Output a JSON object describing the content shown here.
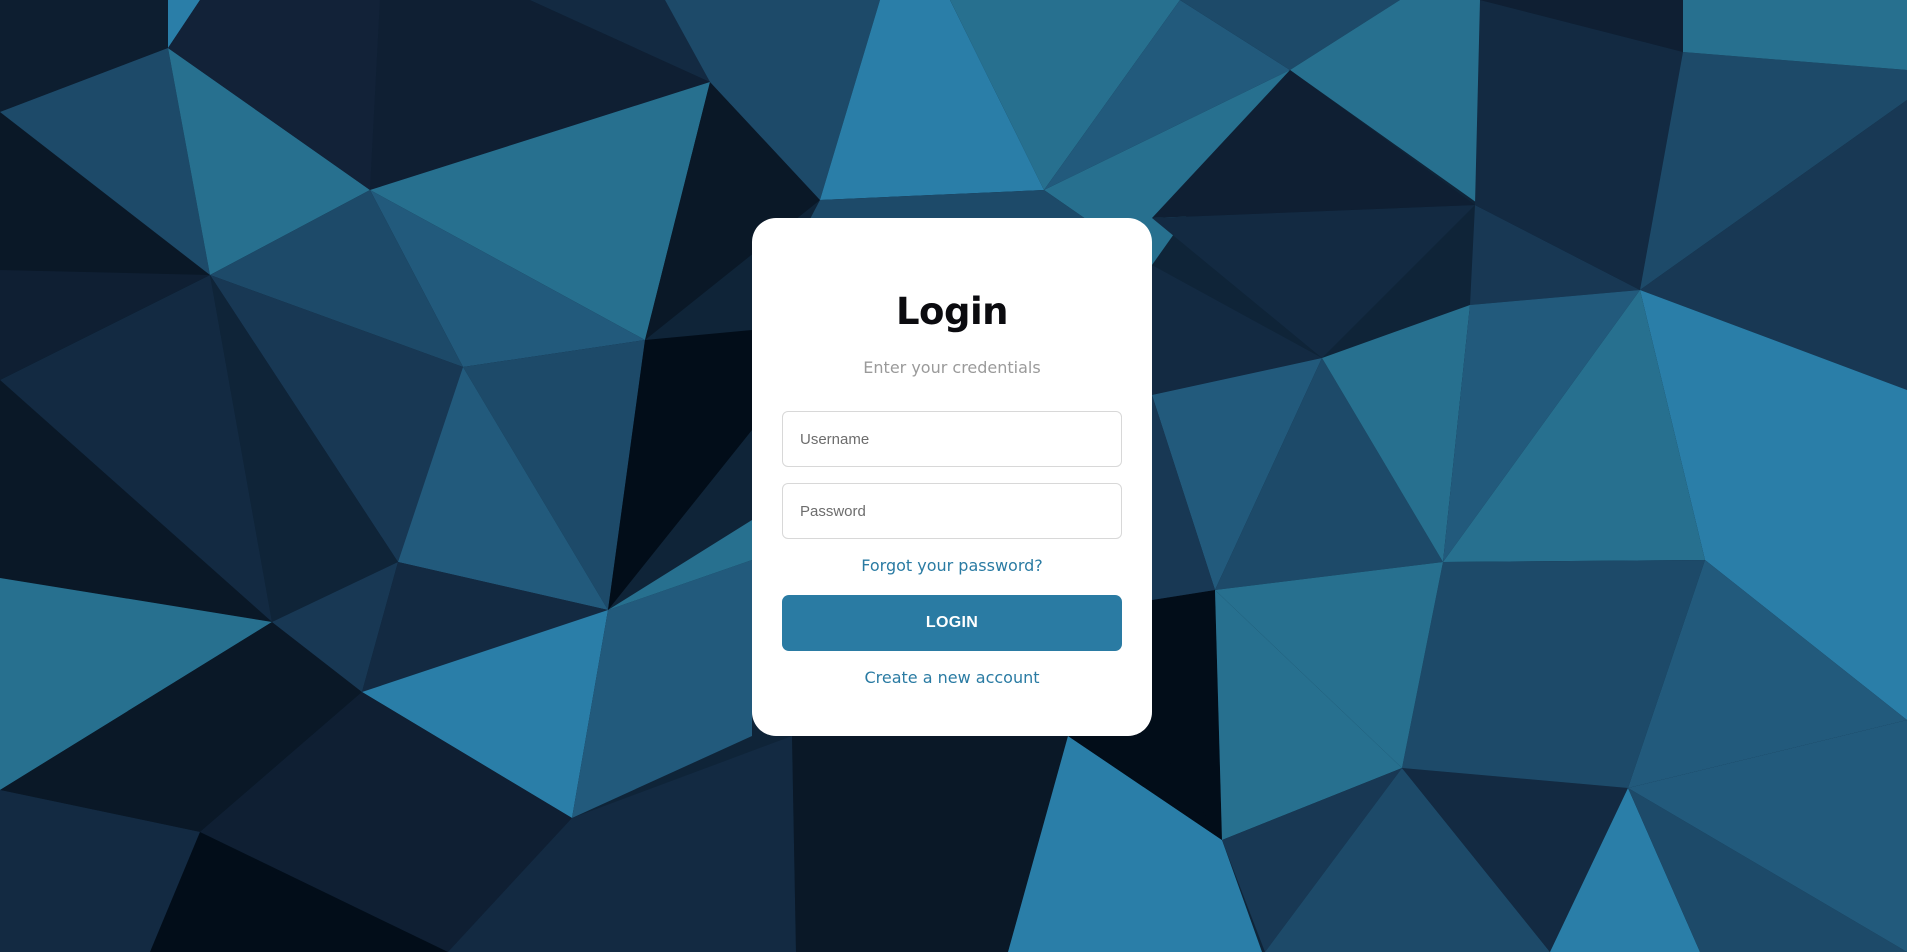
{
  "login": {
    "title": "Login",
    "subtitle": "Enter your credentials",
    "username_value": "",
    "username_placeholder": "Username",
    "password_value": "",
    "password_placeholder": "Password",
    "forgot_link": "Forgot your password?",
    "login_button": "LOGIN",
    "create_account_link": "Create a new account"
  },
  "colors": {
    "accent": "#2a7ba3",
    "card_background": "#ffffff",
    "title_text": "#0b0b0f",
    "subtitle_text": "#9a9a9a",
    "background_palette": [
      "#020d19",
      "#0a1827",
      "#0f1f33",
      "#132a42",
      "#183854",
      "#1d4a69",
      "#225a7c",
      "#27708f",
      "#2a7ea8"
    ]
  }
}
